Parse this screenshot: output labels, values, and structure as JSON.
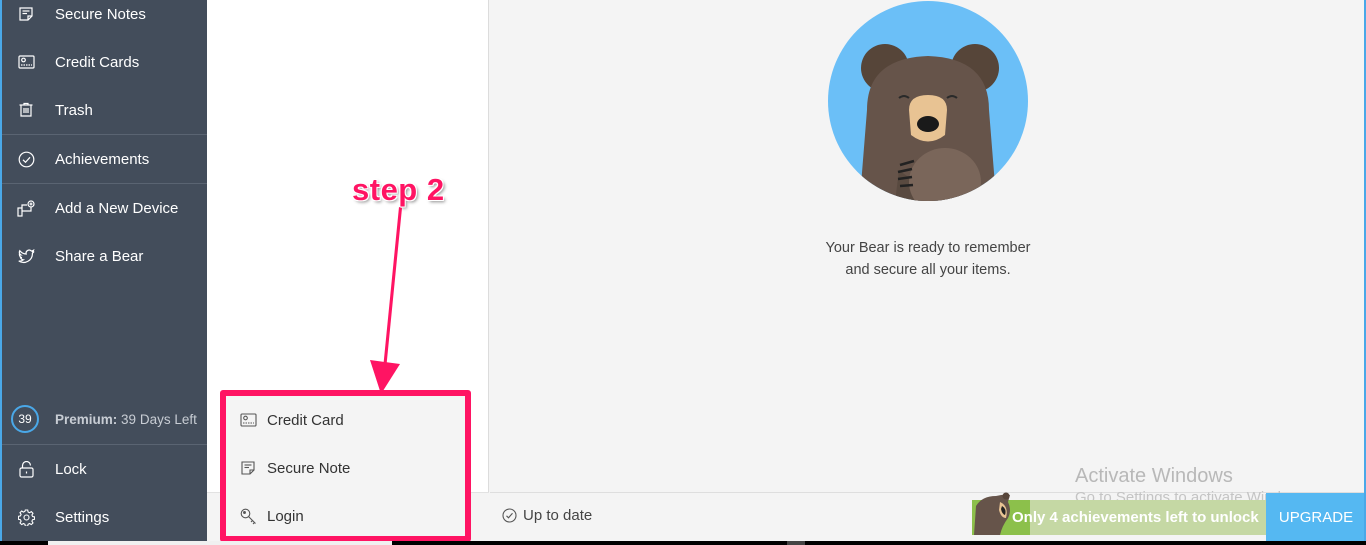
{
  "sidebar": {
    "items": [
      {
        "label": "Secure Notes",
        "icon": "secure-note-icon"
      },
      {
        "label": "Credit Cards",
        "icon": "credit-card-icon"
      },
      {
        "label": "Trash",
        "icon": "trash-icon"
      },
      {
        "label": "Achievements",
        "icon": "check-circle-icon"
      },
      {
        "label": "Add a New Device",
        "icon": "add-device-icon"
      },
      {
        "label": "Share a Bear",
        "icon": "twitter-bird-icon"
      }
    ],
    "premium": {
      "days": "39",
      "label": "Premium:",
      "value": "39 Days Left"
    },
    "lock_label": "Lock",
    "settings_label": "Settings"
  },
  "add_menu": {
    "items": [
      {
        "label": "Credit Card",
        "icon": "credit-card-icon"
      },
      {
        "label": "Secure Note",
        "icon": "secure-note-icon"
      },
      {
        "label": "Login",
        "icon": "key-icon"
      }
    ]
  },
  "annotation": {
    "label": "step 2",
    "color": "#ff1463"
  },
  "main": {
    "empty_line1": "Your Bear is ready to remember",
    "empty_line2": "and secure all your items.",
    "status": "Up to date",
    "achievement_text": "Only 4 achievements left to unlock",
    "upgrade_label": "UPGRADE"
  },
  "watermark": {
    "title": "Activate Windows",
    "subtitle": "Go to Settings to activate Windows."
  },
  "colors": {
    "sidebar_bg": "#434d5b",
    "accent_blue": "#55b8f2",
    "annotation_pink": "#ff1463",
    "achievement_green": "#8cc04b"
  }
}
